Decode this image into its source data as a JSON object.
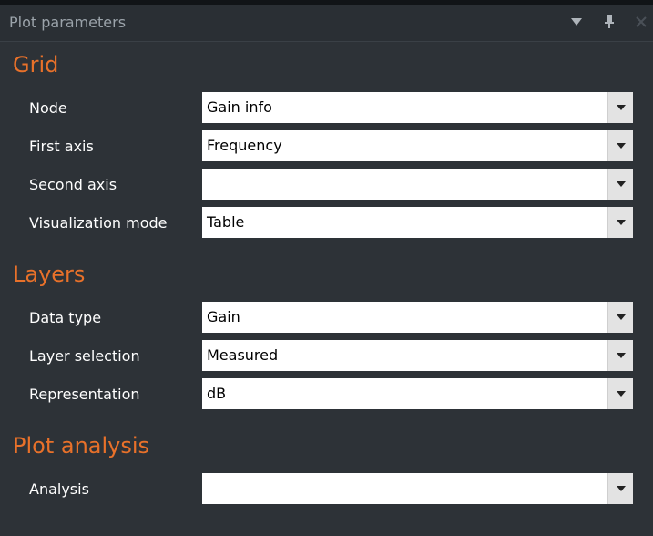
{
  "panel": {
    "title": "Plot parameters"
  },
  "sections": {
    "grid": {
      "title": "Grid",
      "rows": [
        {
          "label": "Node",
          "value": "Gain info"
        },
        {
          "label": "First axis",
          "value": "Frequency"
        },
        {
          "label": "Second axis",
          "value": ""
        },
        {
          "label": "Visualization mode",
          "value": "Table"
        }
      ]
    },
    "layers": {
      "title": "Layers",
      "rows": [
        {
          "label": "Data type",
          "value": "Gain"
        },
        {
          "label": "Layer selection",
          "value": "Measured"
        },
        {
          "label": "Representation",
          "value": "dB"
        }
      ]
    },
    "analysis": {
      "title": "Plot analysis",
      "rows": [
        {
          "label": "Analysis",
          "value": ""
        }
      ]
    }
  },
  "icons": {
    "menu": "dropdown-menu-icon",
    "pin": "pin-icon",
    "close": "close-icon",
    "combo_arrow": "chevron-down-icon"
  },
  "colors": {
    "background": "#2d3237",
    "section_title": "#e8712a",
    "label": "#ffffff",
    "title_text": "#9ba3aa"
  }
}
